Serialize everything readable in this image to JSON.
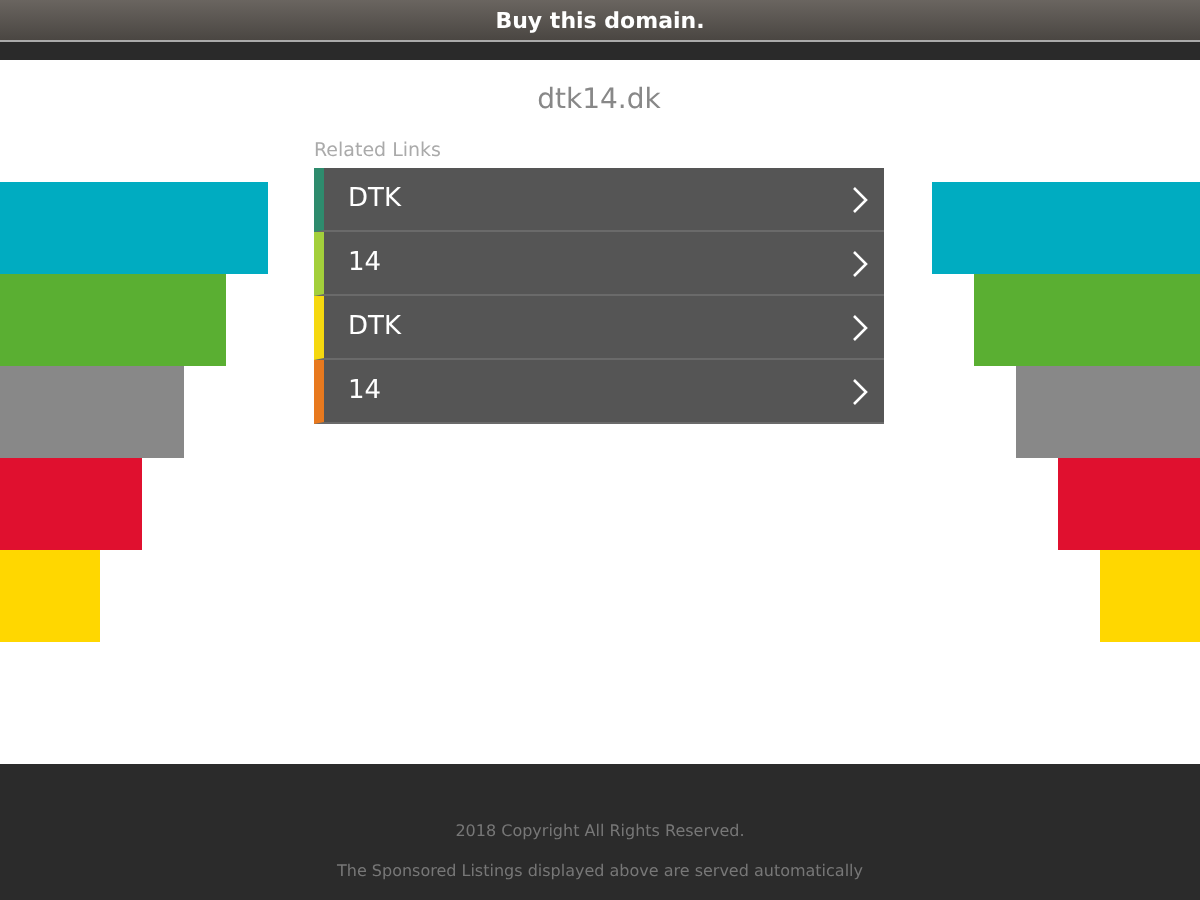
{
  "top_bar": {
    "link": "Buy this domain."
  },
  "domain": "dtk14.dk",
  "related": {
    "heading": "Related Links",
    "items": [
      {
        "label": "DTK",
        "color": "#2e8b6d"
      },
      {
        "label": "14",
        "color": "#a3cf3b"
      },
      {
        "label": "DTK",
        "color": "#f5d80f"
      },
      {
        "label": "14",
        "color": "#e8791e"
      }
    ]
  },
  "footer": {
    "copyright": "2018 Copyright All Rights Reserved.",
    "notice": "The Sponsored Listings displayed above are served automatically"
  }
}
